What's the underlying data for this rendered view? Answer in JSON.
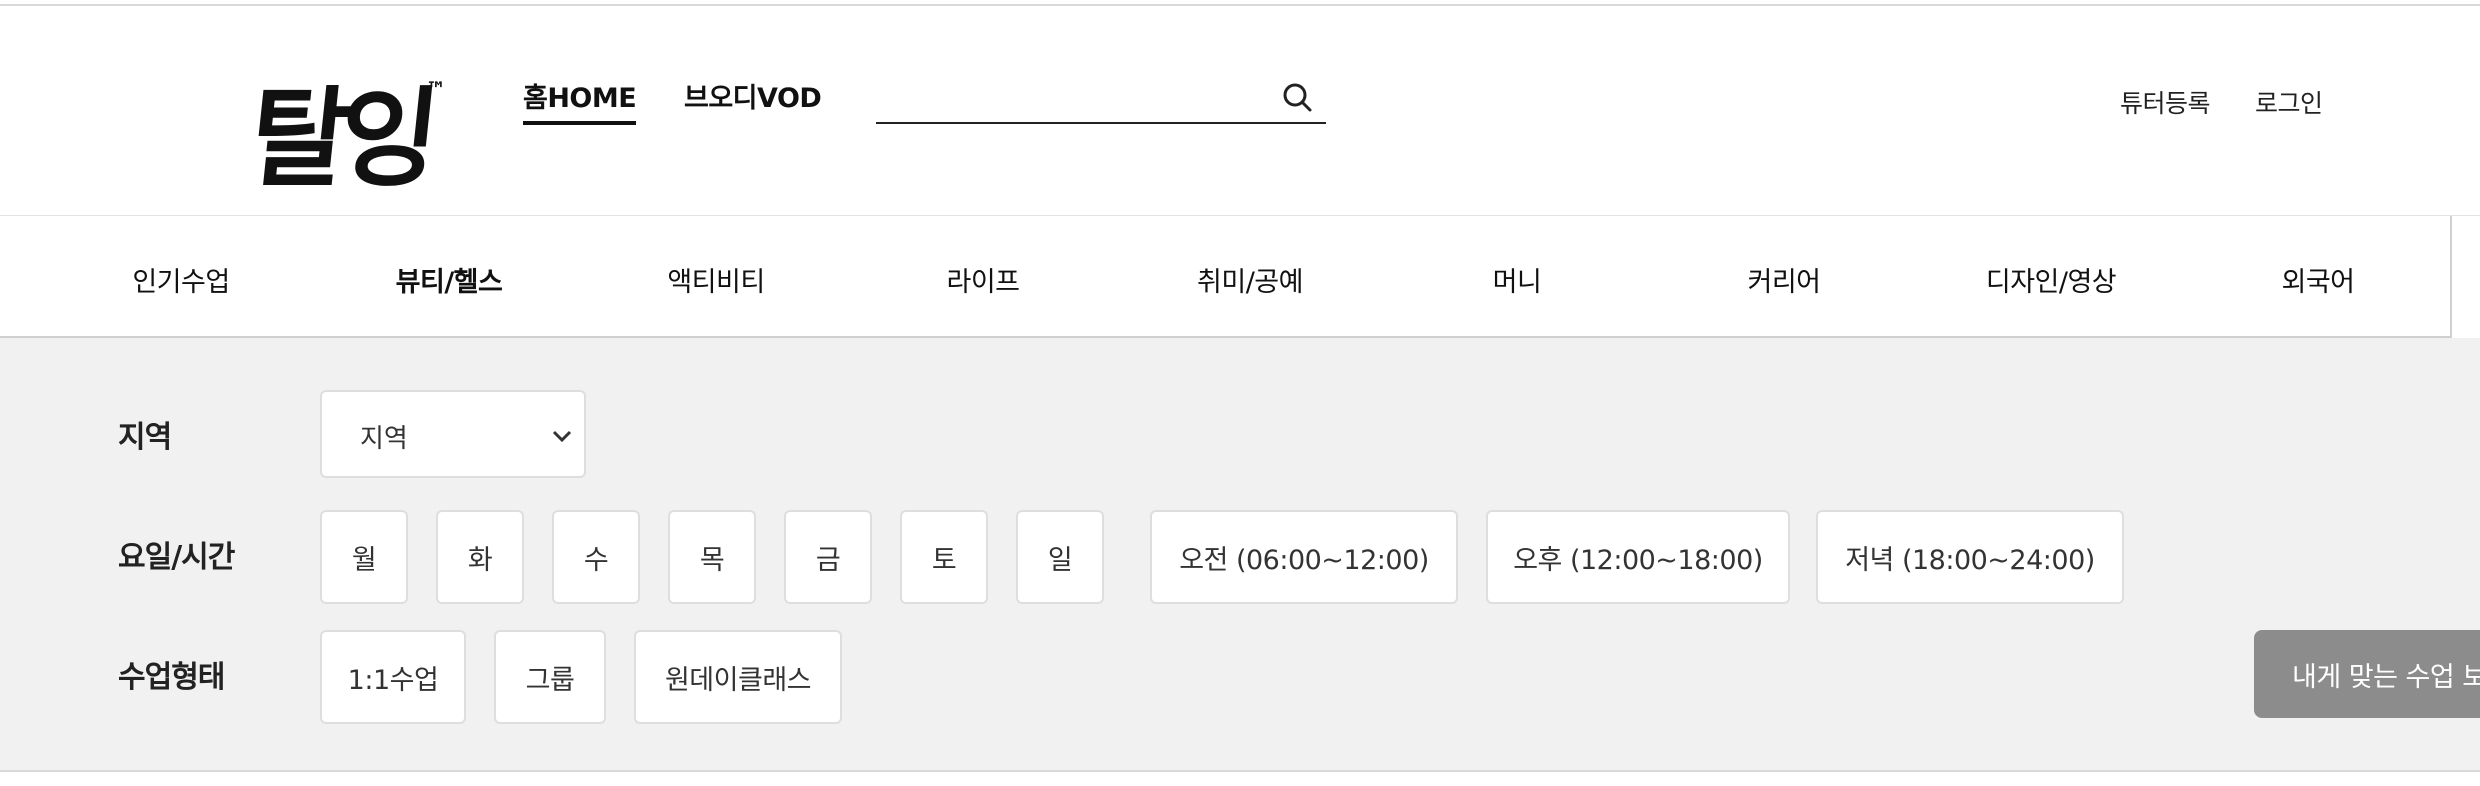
{
  "header": {
    "logo_text": "탈잉",
    "logo_mark": "™",
    "nav": [
      {
        "label": "홈HOME"
      },
      {
        "label": "브오디VOD"
      }
    ],
    "search": {
      "placeholder": "",
      "value": ""
    },
    "util_links": [
      "튜터등록",
      "로그인"
    ]
  },
  "categories": [
    "인기수업",
    "뷰티/헬스",
    "액티비티",
    "라이프",
    "취미/공예",
    "머니",
    "커리어",
    "디자인/영상",
    "외국어"
  ],
  "filters": {
    "region": {
      "label": "지역",
      "selected": "지역"
    },
    "schedule": {
      "label": "요일/시간",
      "days": [
        "월",
        "화",
        "수",
        "목",
        "금",
        "토",
        "일"
      ],
      "times": [
        "오전 (06:00~12:00)",
        "오후 (12:00~18:00)",
        "저녁 (18:00~24:00)"
      ]
    },
    "class_type": {
      "label": "수업형태",
      "options": [
        "1:1수업",
        "그룹",
        "원데이클래스"
      ]
    },
    "submit_label": "내게 맞는 수업 보기"
  },
  "colors": {
    "cta_bg": "#8c8c8c",
    "panel_bg": "#f1f1f1"
  }
}
